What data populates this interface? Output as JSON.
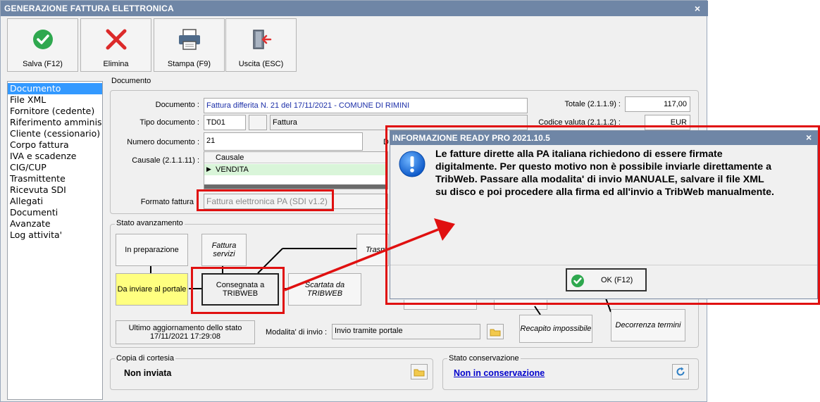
{
  "window": {
    "title": "GENERAZIONE FATTURA ELETTRONICA",
    "close": "×"
  },
  "toolbar": [
    {
      "label": "Salva (F12)",
      "icon": "check-circle-icon"
    },
    {
      "label": "Elimina",
      "icon": "red-x-icon"
    },
    {
      "label": "Stampa (F9)",
      "icon": "printer-icon"
    },
    {
      "label": "Uscita (ESC)",
      "icon": "exit-door-icon"
    }
  ],
  "nav": [
    "Documento",
    "File XML",
    "Fornitore (cedente)",
    "Riferimento amminis",
    "Cliente (cessionario)",
    "Corpo fattura",
    "IVA e scadenze",
    "CIG/CUP",
    "Trasmittente",
    "Ricevuta SDI",
    "Allegati",
    "Documenti",
    "Avanzate",
    "Log attivita'"
  ],
  "documento": {
    "group": "Documento",
    "documento_label": "Documento :",
    "documento_value": "Fattura differita N. 21 del 17/11/2021 - COMUNE DI RIMINI",
    "tipo_label": "Tipo documento :",
    "tipo_code": "TD01",
    "tipo_desc": "Fattura",
    "numero_label": "Numero documento :",
    "numero_value": "21",
    "data_label_fragment": "D",
    "causale_label": "Causale (2.1.1.11) :",
    "causale_header": "Causale",
    "causale_marker": "▶",
    "causale_value": "VENDITA",
    "formato_label": "Formato fattura",
    "formato_value": "Fattura elettronica PA (SDI v1.2)",
    "totale_label": "Totale (2.1.1.9) :",
    "totale_value": "117,00",
    "valuta_label": "Codice valuta (2.1.1.2) :",
    "valuta_value": "EUR"
  },
  "stato": {
    "group": "Stato avanzamento",
    "in_preparazione": "In preparazione",
    "fattura_servizi_1": "Fattura",
    "fattura_servizi_2": "servizi",
    "trasm_fragment": "Trasm",
    "da_inviare": "Da inviare al portale",
    "consegnata_1": "Consegnata a",
    "consegnata_2": "TRIBWEB",
    "scartata_1": "Scartata da",
    "scartata_2": "TRIBWEB",
    "recapito": "Recapito impossibile",
    "decorrenza": "Decorrenza termini",
    "ultimo_1": "Ultimo aggiornamento dello stato",
    "ultimo_2": "17/11/2021 17:29:08",
    "modalita_label": "Modalita' di invio :",
    "modalita_value": "Invio tramite portale"
  },
  "copia": {
    "group": "Copia di cortesia",
    "value": "Non inviata"
  },
  "conservazione": {
    "group": "Stato conservazione",
    "value": "Non in conservazione"
  },
  "dialog": {
    "title": "INFORMAZIONE READY PRO 2021.10.5",
    "close": "×",
    "lines": [
      "Le fatture dirette alla PA italiana richiedono di essere firmate",
      "digitalmente. Per questo motivo non è possibile inviarle direttamente a",
      "TribWeb. Passare alla modalita' di invio MANUALE, salvare il file XML",
      "su disco e poi procedere alla firma ed all'invio a TribWeb manualmente."
    ],
    "ok_label": "OK (F12)"
  },
  "colors": {
    "titlebar": "#6f86a6",
    "highlight": "#ff0000",
    "selected": "#3399ff",
    "yellow": "#ffff80",
    "link": "#0000cc"
  }
}
